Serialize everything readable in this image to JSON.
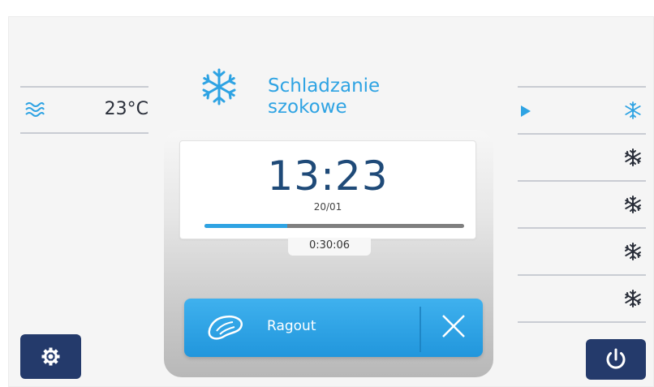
{
  "status": {
    "temperature": "23°C",
    "temperature_icon": "air-waves-icon"
  },
  "mode": {
    "icon": "snowflake-icon",
    "title_line1": "Schladzanie",
    "title_line2": "szokowe"
  },
  "clock": {
    "time": "13:23",
    "date": "20/01"
  },
  "progress": {
    "fraction": 0.32,
    "elapsed": "0:30:06"
  },
  "program": {
    "icon": "meat-icon",
    "label": "Ragout",
    "cancel_icon": "close-icon"
  },
  "right_menu": [
    {
      "icon": "snowflake-small-icon",
      "active": true
    },
    {
      "icon": "snowflake-bold-icon",
      "active": false
    },
    {
      "icon": "snowflake-bold-icon",
      "active": false
    },
    {
      "icon": "snowflake-bold-icon",
      "active": false
    },
    {
      "icon": "snowflake-bold-icon",
      "active": false
    }
  ],
  "buttons": {
    "settings_icon": "gear-icon",
    "power_icon": "power-icon"
  },
  "colors": {
    "accent": "#2ea3e3",
    "navy": "#243a6b",
    "clock_text": "#1f4a78",
    "active_indicator": "#2ea3e3"
  }
}
